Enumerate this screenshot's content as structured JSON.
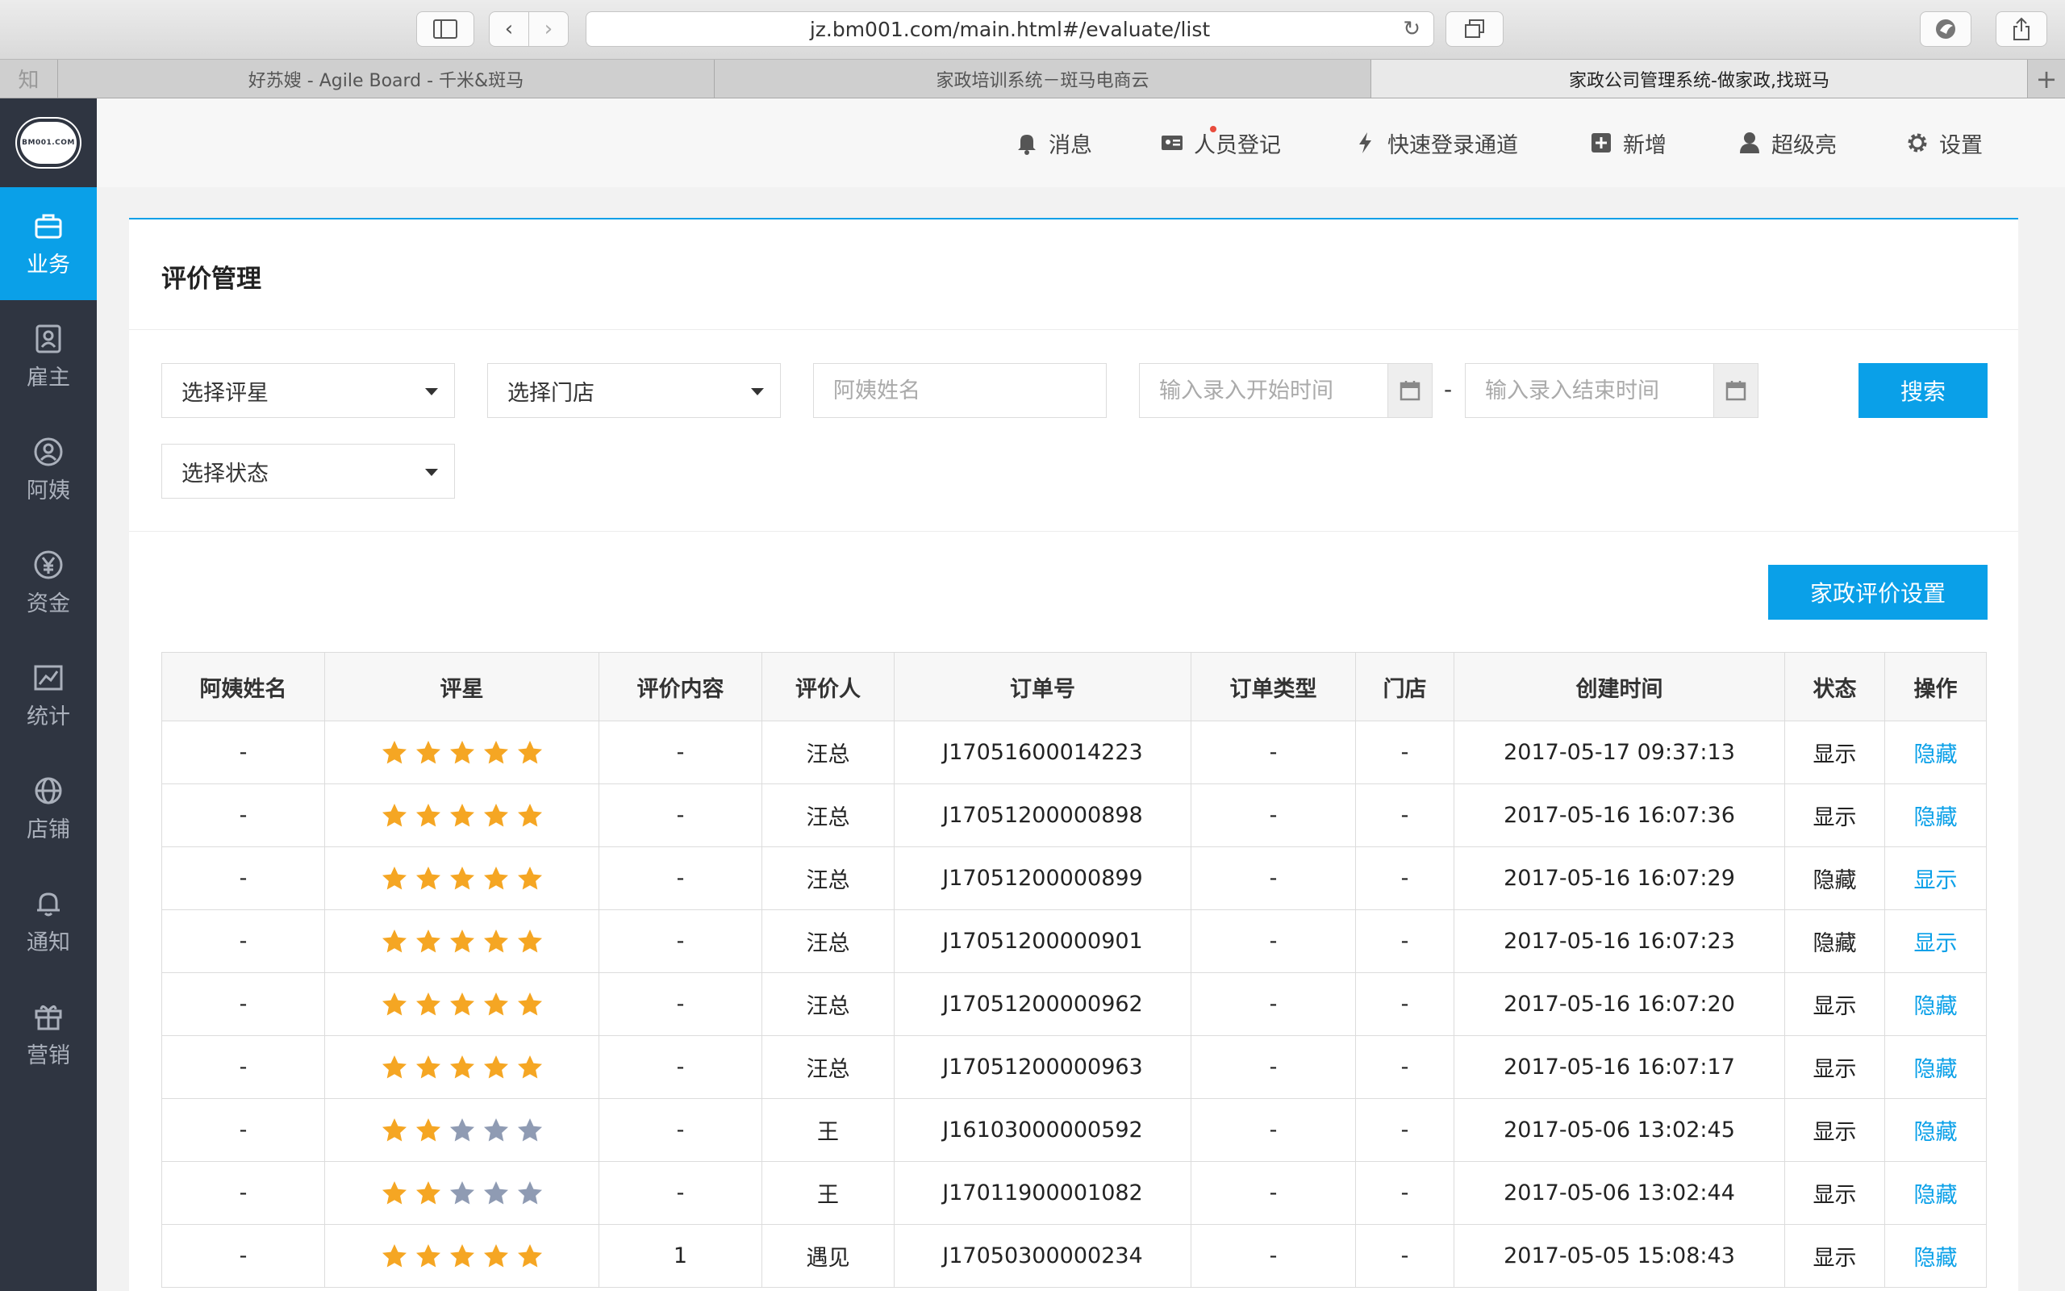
{
  "browser": {
    "url": "jz.bm001.com/main.html#/evaluate/list",
    "favicon_char": "知",
    "tabs": [
      {
        "title": "好苏嫂 - Agile Board - 千米&斑马",
        "active": false
      },
      {
        "title": "家政培训系统－斑马电商云",
        "active": false
      },
      {
        "title": "家政公司管理系统-做家政,找斑马",
        "active": true
      }
    ]
  },
  "logo": {
    "text": "BM001.COM"
  },
  "sidebar": {
    "items": [
      {
        "label": "业务",
        "icon": "briefcase-icon",
        "active": true
      },
      {
        "label": "雇主",
        "icon": "employer-card-icon",
        "active": false
      },
      {
        "label": "阿姨",
        "icon": "person-circle-icon",
        "active": false
      },
      {
        "label": "资金",
        "icon": "yen-icon",
        "active": false
      },
      {
        "label": "统计",
        "icon": "chart-icon",
        "active": false
      },
      {
        "label": "店铺",
        "icon": "globe-icon",
        "active": false
      },
      {
        "label": "通知",
        "icon": "bell-icon",
        "active": false
      },
      {
        "label": "营销",
        "icon": "gift-icon",
        "active": false
      }
    ]
  },
  "topnav": {
    "messages": "消息",
    "register": "人员登记",
    "quick_login": "快速登录通道",
    "add_new": "新增",
    "user": "超级亮",
    "settings": "设置"
  },
  "page": {
    "title": "评价管理"
  },
  "filters": {
    "rating_select": "选择评星",
    "store_select": "选择门店",
    "name_placeholder": "阿姨姓名",
    "start_placeholder": "输入录入开始时间",
    "range_sep": "-",
    "end_placeholder": "输入录入结束时间",
    "status_select": "选择状态",
    "search_label": "搜索"
  },
  "actions": {
    "settings_button": "家政评价设置"
  },
  "colors": {
    "accent": "#0aa0e8",
    "star_filled": "#f5a623",
    "star_empty": "#8f9bb3",
    "sidebar_bg": "#2f3541"
  },
  "table": {
    "headers": [
      "阿姨姓名",
      "评星",
      "评价内容",
      "评价人",
      "订单号",
      "订单类型",
      "门店",
      "创建时间",
      "状态",
      "操作"
    ],
    "rows": [
      {
        "name": "-",
        "stars": 5,
        "content": "-",
        "reviewer": "汪总",
        "order": "J17051600014223",
        "type": "-",
        "store": "-",
        "created": "2017-05-17 09:37:13",
        "status": "显示",
        "action": "隐藏"
      },
      {
        "name": "-",
        "stars": 5,
        "content": "-",
        "reviewer": "汪总",
        "order": "J17051200000898",
        "type": "-",
        "store": "-",
        "created": "2017-05-16 16:07:36",
        "status": "显示",
        "action": "隐藏"
      },
      {
        "name": "-",
        "stars": 5,
        "content": "-",
        "reviewer": "汪总",
        "order": "J17051200000899",
        "type": "-",
        "store": "-",
        "created": "2017-05-16 16:07:29",
        "status": "隐藏",
        "action": "显示"
      },
      {
        "name": "-",
        "stars": 5,
        "content": "-",
        "reviewer": "汪总",
        "order": "J17051200000901",
        "type": "-",
        "store": "-",
        "created": "2017-05-16 16:07:23",
        "status": "隐藏",
        "action": "显示"
      },
      {
        "name": "-",
        "stars": 5,
        "content": "-",
        "reviewer": "汪总",
        "order": "J17051200000962",
        "type": "-",
        "store": "-",
        "created": "2017-05-16 16:07:20",
        "status": "显示",
        "action": "隐藏"
      },
      {
        "name": "-",
        "stars": 5,
        "content": "-",
        "reviewer": "汪总",
        "order": "J17051200000963",
        "type": "-",
        "store": "-",
        "created": "2017-05-16 16:07:17",
        "status": "显示",
        "action": "隐藏"
      },
      {
        "name": "-",
        "stars": 2,
        "content": "-",
        "reviewer": "王",
        "order": "J16103000000592",
        "type": "-",
        "store": "-",
        "created": "2017-05-06 13:02:45",
        "status": "显示",
        "action": "隐藏"
      },
      {
        "name": "-",
        "stars": 2,
        "content": "-",
        "reviewer": "王",
        "order": "J17011900001082",
        "type": "-",
        "store": "-",
        "created": "2017-05-06 13:02:44",
        "status": "显示",
        "action": "隐藏"
      },
      {
        "name": "-",
        "stars": 5,
        "content": "1",
        "reviewer": "遇见",
        "order": "J17050300000234",
        "type": "-",
        "store": "-",
        "created": "2017-05-05 15:08:43",
        "status": "显示",
        "action": "隐藏"
      }
    ]
  }
}
